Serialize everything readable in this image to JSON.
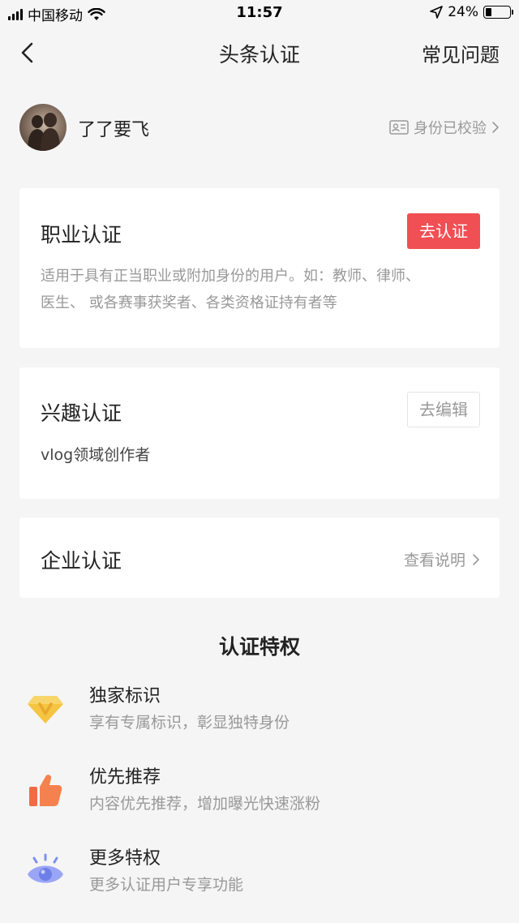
{
  "status_bar": {
    "carrier": "中国移动",
    "time": "11:57",
    "battery_percent": "24%",
    "battery_level": 0.24
  },
  "nav": {
    "title": "头条认证",
    "faq_label": "常见问题"
  },
  "profile": {
    "username": "了了要飞",
    "verified_label": "身份已校验"
  },
  "cards": {
    "professional": {
      "title": "职业认证",
      "button_label": "去认证",
      "description_line1": "适用于具有正当职业或附加身份的用户。如：教师、律师、",
      "description_line2": "医生、 或各赛事获奖者、各类资格证持有者等"
    },
    "interest": {
      "title": "兴趣认证",
      "button_label": "去编辑",
      "subtitle": "vlog领域创作者"
    },
    "enterprise": {
      "title": "企业认证",
      "link_label": "查看说明"
    }
  },
  "privileges": {
    "title": "认证特权",
    "items": [
      {
        "title": "独家标识",
        "desc": "享有专属标识，彰显独特身份",
        "icon": "diamond-v-icon"
      },
      {
        "title": "优先推荐",
        "desc": "内容优先推荐，增加曝光快速涨粉",
        "icon": "thumbs-up-icon"
      },
      {
        "title": "更多特权",
        "desc": "更多认证用户专享功能",
        "icon": "eye-icon"
      }
    ]
  },
  "colors": {
    "accent": "#f04f54",
    "background": "#f5f5f5",
    "muted_text": "#999999"
  }
}
